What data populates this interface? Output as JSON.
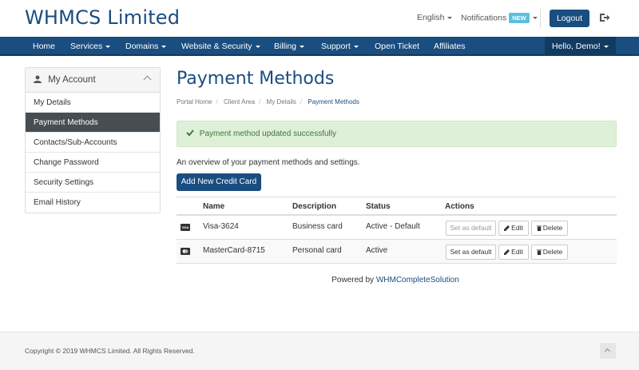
{
  "header": {
    "brand": "WHMCS Limited",
    "language": "English",
    "notifications_label": "Notifications",
    "notifications_badge": "NEW",
    "logout_label": "Logout"
  },
  "nav": {
    "items": [
      {
        "label": "Home",
        "has_dropdown": false
      },
      {
        "label": "Services",
        "has_dropdown": true
      },
      {
        "label": "Domains",
        "has_dropdown": true
      },
      {
        "label": "Website & Security",
        "has_dropdown": true
      },
      {
        "label": "Billing",
        "has_dropdown": true
      },
      {
        "label": "Support",
        "has_dropdown": true
      },
      {
        "label": "Open Ticket",
        "has_dropdown": false
      },
      {
        "label": "Affiliates",
        "has_dropdown": false
      }
    ],
    "user_greeting": "Hello, Demo!"
  },
  "sidebar": {
    "title": "My Account",
    "items": [
      {
        "label": "My Details",
        "active": false
      },
      {
        "label": "Payment Methods",
        "active": true
      },
      {
        "label": "Contacts/Sub-Accounts",
        "active": false
      },
      {
        "label": "Change Password",
        "active": false
      },
      {
        "label": "Security Settings",
        "active": false
      },
      {
        "label": "Email History",
        "active": false
      }
    ]
  },
  "main": {
    "title": "Payment Methods",
    "breadcrumb": [
      "Portal Home",
      "Client Area",
      "My Details",
      "Payment Methods"
    ],
    "alert": "Payment method updated successfully",
    "overview": "An overview of your payment methods and settings.",
    "add_button": "Add New Credit Card",
    "table": {
      "headers": [
        "Name",
        "Description",
        "Status",
        "Actions"
      ],
      "rows": [
        {
          "icon": "visa-card-icon",
          "name": "Visa-3624",
          "description": "Business card",
          "status": "Active - Default",
          "default_btn": "Set as default",
          "edit_btn": "Edit",
          "delete_btn": "Delete",
          "default_disabled": true
        },
        {
          "icon": "mastercard-icon",
          "name": "MasterCard-8715",
          "description": "Personal card",
          "status": "Active",
          "default_btn": "Set as default",
          "edit_btn": "Edit",
          "delete_btn": "Delete",
          "default_disabled": false
        }
      ]
    },
    "powered_prefix": "Powered by",
    "powered_link": "WHMCompleteSolution"
  },
  "footer": {
    "copyright": "Copyright © 2019 WHMCS Limited. All Rights Reserved."
  },
  "colors": {
    "brand": "#1a4d80",
    "nav_bg": "#1a4d80",
    "sidebar_active": "#464e53",
    "alert_bg": "#dff0d8",
    "alert_text": "#3c763d"
  }
}
